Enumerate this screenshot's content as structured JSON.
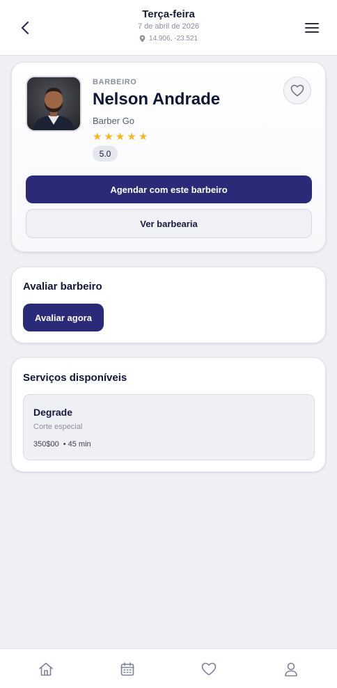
{
  "header": {
    "day": "Terça-feira",
    "date": "7 de abril de 2026",
    "coordinates": "14.906, -23.521",
    "icons": {
      "back": "chevron-left-icon",
      "menu": "hamburger-menu-icon",
      "location": "map-pin-icon"
    }
  },
  "barber": {
    "role": "BARBEIRO",
    "name": "Nelson Andrade",
    "shop": "Barber Go",
    "stars": 5,
    "rating": "5.0",
    "photo_icon": "barber-avatar",
    "favorite_icon": "heart-icon"
  },
  "actions": {
    "book_label": "Agendar com este barbeiro",
    "view_shop_label": "Ver barbearia"
  },
  "rate_section": {
    "title": "Avaliar barbeiro",
    "button_label": "Avaliar agora"
  },
  "services_section": {
    "title": "Serviços disponíveis",
    "items": [
      {
        "name": "Degrade",
        "description": "Corte especial",
        "price": "350$00",
        "duration": "• 45 min"
      }
    ]
  },
  "bottom_nav": {
    "items": [
      {
        "icon": "home-icon"
      },
      {
        "icon": "calendar-icon"
      },
      {
        "icon": "heart-icon"
      },
      {
        "icon": "user-icon"
      }
    ]
  },
  "colors": {
    "primary": "#2b2a78",
    "background": "#eef0f4",
    "star": "#f5b81c",
    "text": "#101638",
    "muted": "#8a8f9c"
  }
}
